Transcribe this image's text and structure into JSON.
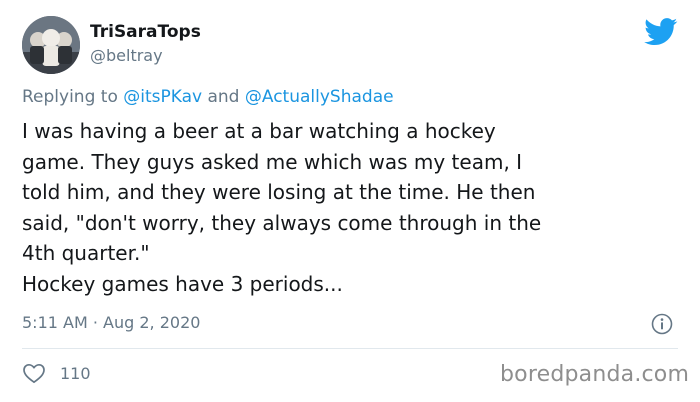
{
  "author": {
    "name": "TriSaraTops",
    "handle": "@beltray"
  },
  "reply": {
    "prefix": "Replying to",
    "mention1": "@itsPKav",
    "joiner": "and",
    "mention2": "@ActuallyShadae"
  },
  "tweet": {
    "lines": [
      "I was having a beer at a bar watching a hockey",
      "game. They guys asked me which was my team, I",
      "told him, and they were losing at the time. He then",
      "said, \"don't worry, they always come through in the",
      "4th quarter.\"",
      "Hockey games have 3 periods..."
    ],
    "time": "5:11 AM · Aug 2, 2020"
  },
  "engagement": {
    "likes": "110"
  },
  "watermark": "boredpanda.com",
  "icons": {
    "brand": "twitter-bird-icon",
    "info": "info-icon",
    "like": "heart-icon"
  },
  "colors": {
    "brand": "#1da1f2",
    "mention": "#1b95e0",
    "secondary_text": "#657786",
    "primary_text": "#14171a"
  }
}
